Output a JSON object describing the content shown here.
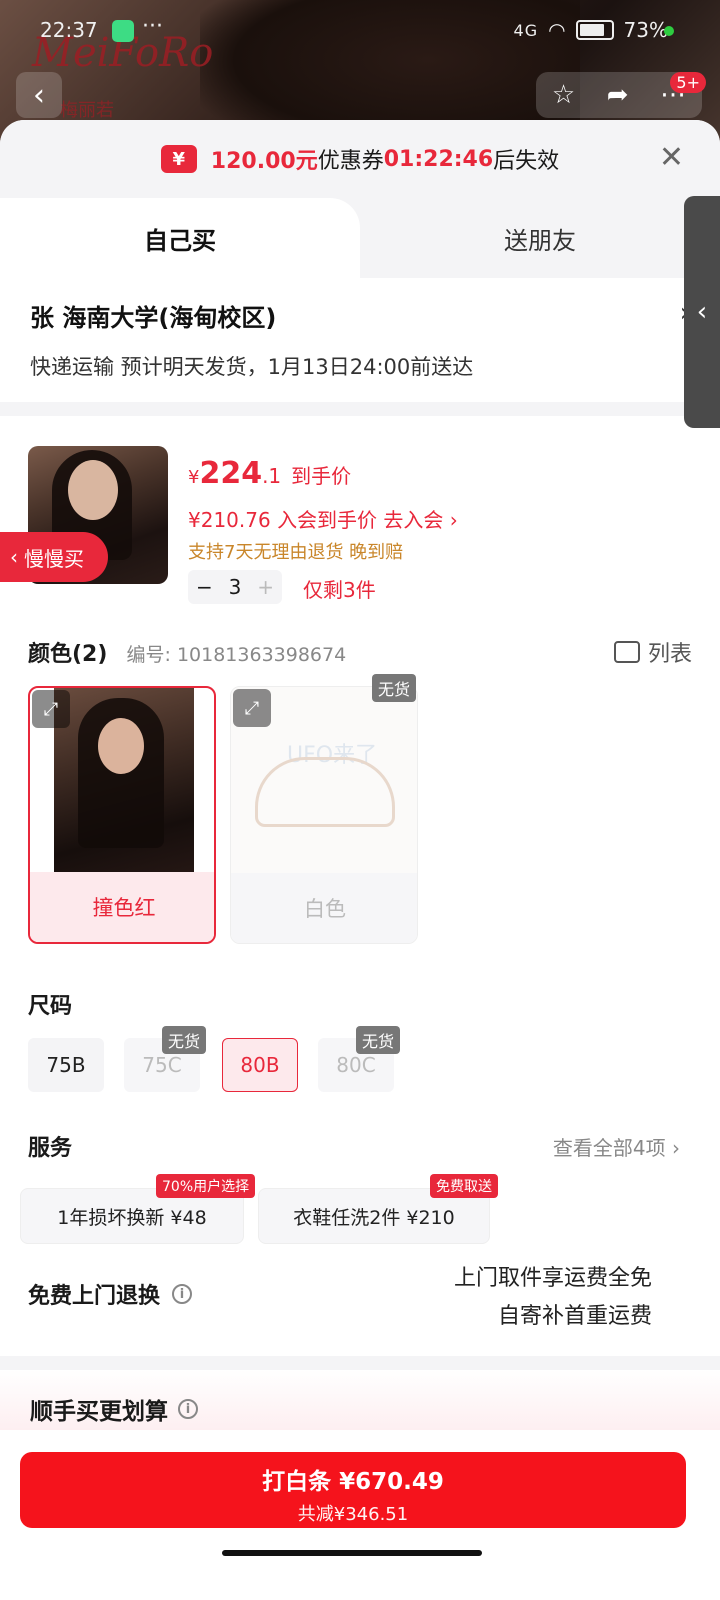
{
  "status_bar": {
    "time": "22:37",
    "dots": "···",
    "network": "4G",
    "battery": "73%"
  },
  "background": {
    "brand": "MeiFoRo",
    "brand_sub": "梅丽若"
  },
  "top": {
    "back": "‹",
    "badge": "5+"
  },
  "coupon": {
    "icon": "¥",
    "amount": "120.00元",
    "text": "优惠券",
    "countdown": "01:22:46",
    "suffix": "后失效"
  },
  "tabs": {
    "self": "自己买",
    "friend": "送朋友"
  },
  "address": {
    "line1": "张  海南大学(海甸校区)",
    "line2": "快递运输 预计明天发货，1月13日24:00前送达"
  },
  "product": {
    "price_yen": "¥",
    "price_int": "224",
    "price_dec": ".1",
    "price_label": "到手价",
    "member_line": "¥210.76 入会到手价 去入会 ›",
    "return_line": "支持7天无理由退货 晚到赔",
    "qty_minus": "−",
    "qty": "3",
    "qty_plus": "+",
    "stock_left": "仅剩3件"
  },
  "slow_buy": {
    "label": "慢慢买"
  },
  "colors": {
    "title": "颜色(2)",
    "code": "编号: 10181363398674",
    "list_toggle": "列表",
    "items": [
      {
        "label": "撞色红",
        "selected": true
      },
      {
        "label": "白色",
        "soldout_tag": "无货",
        "watermark": "UFO来了"
      }
    ]
  },
  "sizes": {
    "title": "尺码",
    "options": [
      {
        "label": "75B",
        "state": "normal"
      },
      {
        "label": "75C",
        "state": "soldout",
        "tag": "无货"
      },
      {
        "label": "80B",
        "state": "selected"
      },
      {
        "label": "80C",
        "state": "soldout",
        "tag": "无货"
      }
    ]
  },
  "services": {
    "title": "服务",
    "view_all": "查看全部4项 ›",
    "items": [
      {
        "label": "1年损坏换新  ¥48",
        "tag": "70%用户选择"
      },
      {
        "label": "衣鞋任洗2件  ¥210",
        "tag": "免费取送"
      }
    ]
  },
  "free_return": {
    "title": "免费上门退换",
    "desc_line1": "上门取件享运费全免",
    "desc_line2": "自寄补首重运费"
  },
  "bundle": {
    "title": "顺手买更划算"
  },
  "buy": {
    "main": "打白条 ¥670.49",
    "sub": "共减¥346.51"
  },
  "colors_theme": {
    "accent": "#e8283b",
    "button": "#f5131c",
    "gold": "#c9862a"
  }
}
